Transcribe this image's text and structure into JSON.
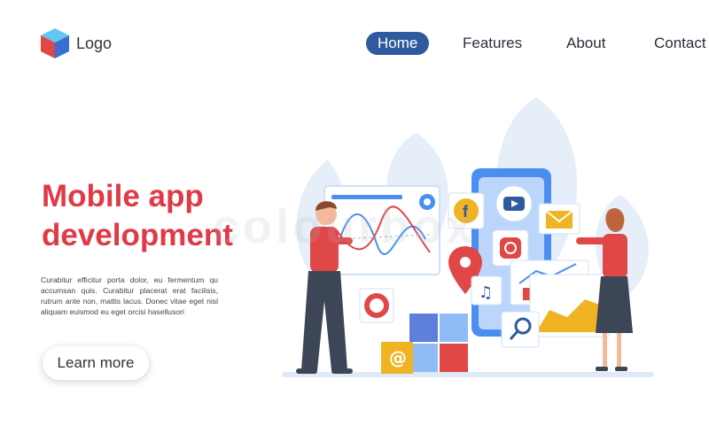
{
  "header": {
    "logo_label": "Logo",
    "nav": [
      {
        "label": "Home",
        "active": true
      },
      {
        "label": "Features",
        "active": false
      },
      {
        "label": "About",
        "active": false
      },
      {
        "label": "Contact",
        "active": false
      }
    ]
  },
  "hero": {
    "title_line1": "Mobile app",
    "title_line2": "development",
    "description": "Curabitur efficitur porta dolor, eu fermentum qu accumsan quis. Curabitur placerat erat facilisis, rutrum ante non, mattis lacus. Donec vitae eget nisl aliquam euismod eu eget orcisi hasellusori",
    "cta_label": "Learn more"
  },
  "watermark": "colourbox",
  "colors": {
    "accent_red": "#e03a46",
    "nav_active": "#2f5a9e",
    "illustration_blue": "#4a8ef0"
  },
  "icons": [
    "cube-logo-icon",
    "facebook-icon",
    "youtube-icon",
    "mail-icon",
    "instagram-icon",
    "location-pin-icon",
    "music-note-icon",
    "search-icon",
    "at-sign-icon",
    "gear-icon",
    "donut-chart-icon",
    "bar-chart-icon"
  ]
}
